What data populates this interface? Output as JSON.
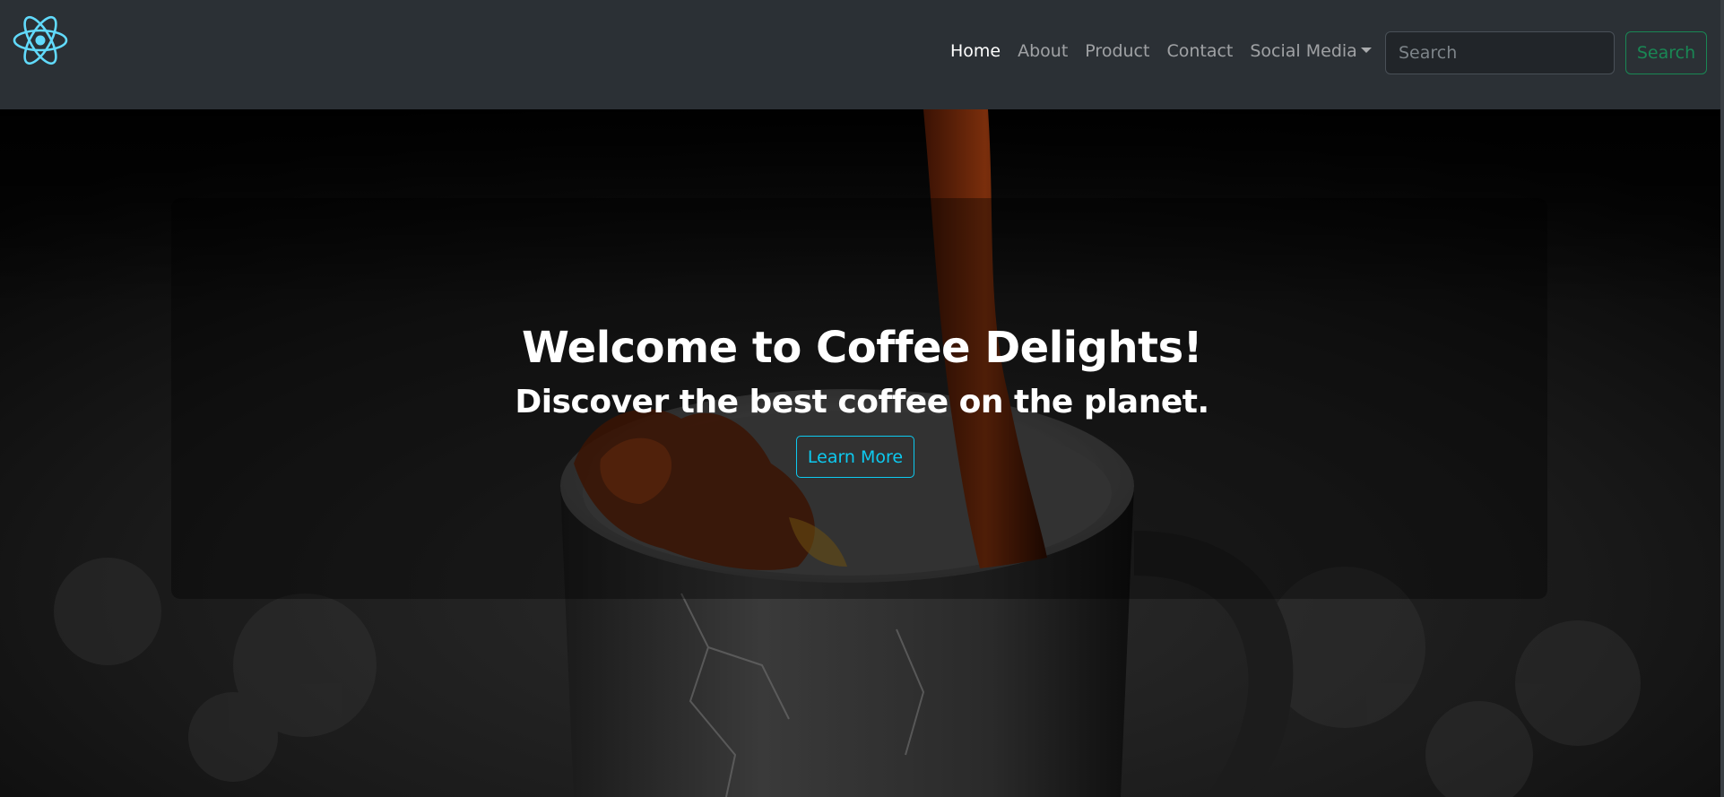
{
  "brand": {
    "logo_icon": "react-atom-icon",
    "logo_color": "#61dafb"
  },
  "nav": {
    "items": [
      {
        "label": "Home",
        "active": true
      },
      {
        "label": "About"
      },
      {
        "label": "Product"
      },
      {
        "label": "Contact"
      },
      {
        "label": "Social Media",
        "dropdown": true
      }
    ]
  },
  "search": {
    "placeholder": "Search",
    "button_label": "Search"
  },
  "hero": {
    "title": "Welcome to Coffee Delights!",
    "subtitle": "Discover the best coffee on the planet.",
    "cta_label": "Learn More"
  },
  "colors": {
    "navbar_bg": "#2b3035",
    "search_button": "#198754",
    "cta": "#0dcaf0",
    "coffee": "#6b2a0c"
  }
}
